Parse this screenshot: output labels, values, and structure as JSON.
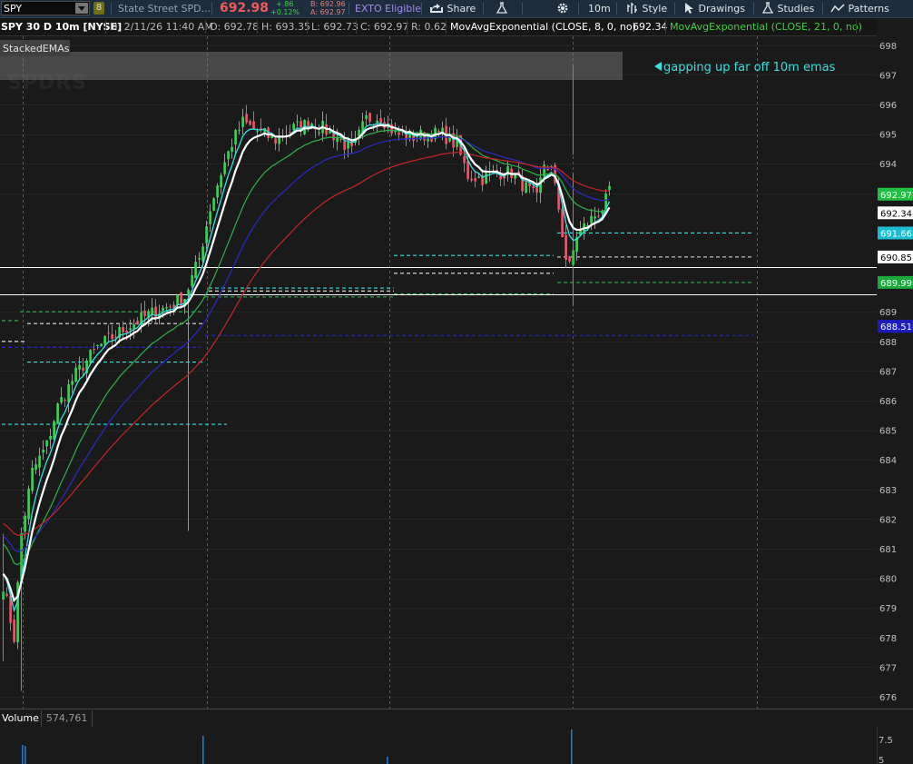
{
  "toolbar": {
    "symbol": "SPY",
    "symbol_badge": "8",
    "company_name": "State Street SPD...",
    "last_price": "692.98",
    "net_change": "+.86",
    "percent_change": "+0.12%",
    "bid": "B: 692.96",
    "ask": "A: 692.97",
    "exto_label": "EXTO Eligible",
    "share_label": "Share",
    "timeframe_label": "10m",
    "style_label": "Style",
    "drawings_label": "Drawings",
    "studies_label": "Studies",
    "patterns_label": "Patterns"
  },
  "infobar": {
    "title": "SPY 30 D 10m [NYSE]",
    "date": "D: 2/11/26 11:40 AM",
    "open": "O: 692.78",
    "high": "H: 693.35",
    "low": "L: 692.73",
    "close": "C: 692.97",
    "range": "R: 0.62",
    "study1": "MovAvgExponential (CLOSE, 8, 0, no)",
    "study1_value": "692.34",
    "study2": "MovAvgExponential (CLOSE, 21, 0, no)"
  },
  "overlay": {
    "study_label": "StackedEMAs",
    "watermark": "SPDRS",
    "annotation": "gapping up far off 10m emas"
  },
  "volume": {
    "label": "Volume",
    "value": "574,761",
    "ticks": [
      "7.5",
      "5"
    ]
  },
  "colors": {
    "up": "#3fd15a",
    "down": "#e8596d",
    "ema8": "#ffffff",
    "ema_cyan": "#38e0e0",
    "ema_green": "#2fb24a",
    "ema_blue": "#2a2ac8",
    "ema_red": "#c62626"
  },
  "chart_data": {
    "type": "candlestick",
    "ylim": [
      675.6,
      698.3
    ],
    "y_ticks": [
      698,
      697,
      696,
      695,
      694,
      693,
      689,
      688,
      687,
      686,
      685,
      684,
      683,
      682,
      681,
      680,
      679,
      678,
      677,
      676
    ],
    "price_labels": [
      {
        "text": "692.97",
        "kind": "last"
      },
      {
        "text": "692.34",
        "kind": "ema8"
      },
      {
        "text": "691.66",
        "kind": "cyan"
      },
      {
        "text": "690.85",
        "kind": "white"
      },
      {
        "text": "689.99",
        "kind": "green"
      },
      {
        "text": "688.51",
        "kind": "blue"
      }
    ],
    "overlay_hlines": [
      690.5,
      689.6
    ],
    "key_close_path": [
      [
        0,
        679.8
      ],
      [
        3,
        678.0
      ],
      [
        5,
        681.5
      ],
      [
        8,
        683.6
      ],
      [
        12,
        684.5
      ],
      [
        15,
        685.8
      ],
      [
        20,
        686.9
      ],
      [
        26,
        687.8
      ],
      [
        33,
        688.4
      ],
      [
        40,
        688.9
      ],
      [
        46,
        689.2
      ],
      [
        50,
        689.5
      ],
      [
        54,
        690.8
      ],
      [
        57,
        692.5
      ],
      [
        60,
        693.7
      ],
      [
        63,
        694.7
      ],
      [
        66,
        695.4
      ],
      [
        70,
        695.1
      ],
      [
        75,
        694.8
      ],
      [
        80,
        695.2
      ],
      [
        85,
        695.4
      ],
      [
        88,
        695.2
      ],
      [
        92,
        694.9
      ],
      [
        96,
        694.4
      ],
      [
        100,
        695.5
      ],
      [
        104,
        695.6
      ],
      [
        108,
        695.0
      ],
      [
        113,
        694.9
      ],
      [
        117,
        695.0
      ],
      [
        121,
        695.0
      ],
      [
        125,
        694.6
      ],
      [
        128,
        693.6
      ],
      [
        132,
        693.5
      ],
      [
        136,
        693.7
      ],
      [
        140,
        693.7
      ],
      [
        143,
        693.3
      ],
      [
        147,
        692.8
      ],
      [
        149,
        694.0
      ],
      [
        151,
        693.8
      ],
      [
        153,
        692.5
      ],
      [
        155,
        690.8
      ],
      [
        156,
        690.5
      ],
      [
        158,
        691.6
      ],
      [
        161,
        692.0
      ],
      [
        165,
        692.5
      ],
      [
        167,
        693.0
      ]
    ],
    "reference_levels": [
      {
        "name": "cyan",
        "segments": [
          [
            0,
            62,
            685.2
          ],
          [
            7,
            56,
            687.3
          ],
          [
            57,
            108,
            689.8
          ],
          [
            108,
            152,
            690.9
          ],
          [
            153,
            207,
            691.66
          ]
        ]
      },
      {
        "name": "white",
        "segments": [
          [
            0,
            7,
            688.0
          ],
          [
            7,
            56,
            688.6
          ],
          [
            57,
            108,
            689.7
          ],
          [
            108,
            152,
            690.3
          ],
          [
            153,
            207,
            690.85
          ]
        ]
      },
      {
        "name": "green",
        "segments": [
          [
            0,
            5,
            688.7
          ],
          [
            5,
            55,
            689.0
          ],
          [
            56,
            108,
            689.5
          ],
          [
            108,
            152,
            689.6
          ],
          [
            153,
            207,
            689.99
          ]
        ]
      },
      {
        "name": "blue",
        "segments": [
          [
            0,
            55,
            687.8
          ],
          [
            56,
            207,
            688.2
          ]
        ]
      }
    ]
  }
}
